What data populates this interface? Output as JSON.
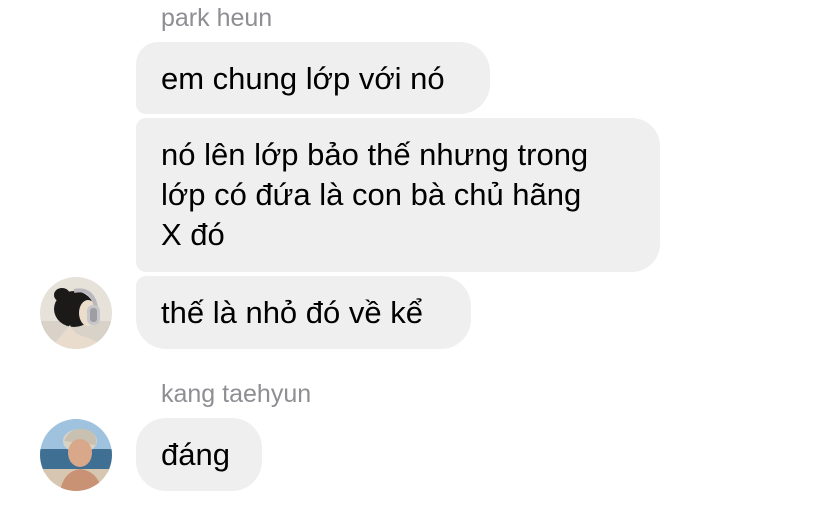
{
  "conversation": {
    "groups": [
      {
        "sender": "park heun",
        "avatar_icon": "person-headphones-avatar",
        "messages": [
          {
            "lines": [
              "em chung lớp với nó"
            ]
          },
          {
            "lines": [
              "nó lên lớp bảo thế nhưng trong",
              "lớp có đứa là con bà chủ hãng",
              "X đó"
            ]
          },
          {
            "lines": [
              "thế là nhỏ đó về kể"
            ]
          }
        ]
      },
      {
        "sender": "kang taehyun",
        "avatar_icon": "person-beach-avatar",
        "messages": [
          {
            "lines": [
              "đáng"
            ]
          }
        ]
      }
    ]
  },
  "colors": {
    "bubble_bg": "#efefef",
    "sender_name": "#8e8e93",
    "text": "#000000"
  }
}
